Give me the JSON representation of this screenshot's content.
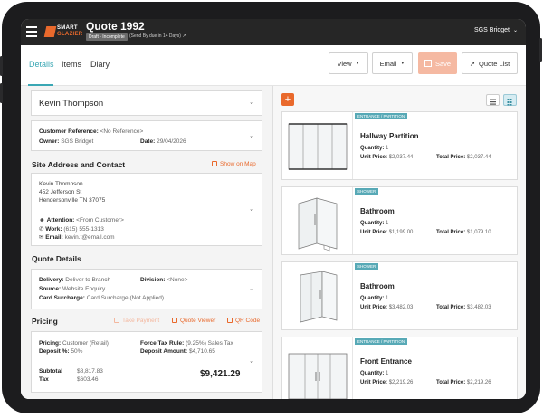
{
  "header": {
    "brand_line1": "SMART",
    "brand_line2": "GLAZIER",
    "title": "Quote 1992",
    "status_badge": "Draft - Incomplete",
    "send_by": "(Send By due in 14 Days)",
    "company": "SGS Bridget"
  },
  "tabs": [
    {
      "label": "Details",
      "active": true
    },
    {
      "label": "Items",
      "active": false
    },
    {
      "label": "Diary",
      "active": false
    }
  ],
  "toolbar": {
    "view_label": "View",
    "email_label": "Email",
    "save_label": "Save",
    "quote_list_label": "Quote List"
  },
  "customer": {
    "name": "Kevin Thompson",
    "reference_label": "Customer Reference:",
    "reference_value": "<No Reference>",
    "owner_label": "Owner:",
    "owner_value": "SGS Bridget",
    "date_label": "Date:",
    "date_value": "29/04/2026"
  },
  "site": {
    "section_title": "Site Address and Contact",
    "show_on_map": "Show on Map",
    "address_lines": [
      "Kevin Thompson",
      "452 Jefferson St",
      "Hendersonville TN 37075"
    ],
    "attention_label": "Attention:",
    "attention_value": "<From Customer>",
    "work_label": "Work:",
    "work_value": "(615) 555-1313",
    "email_label": "Email:",
    "email_value": "kevin.t@email.com"
  },
  "quote_details": {
    "section_title": "Quote Details",
    "delivery_label": "Delivery:",
    "delivery_value": "Deliver to Branch",
    "division_label": "Division:",
    "division_value": "<None>",
    "source_label": "Source:",
    "source_value": "Website Enquiry",
    "surcharge_label": "Card Surcharge:",
    "surcharge_value": "Card Surcharge (Not Applied)"
  },
  "pricing": {
    "section_title": "Pricing",
    "take_payment": "Take Payment",
    "quote_viewer": "Quote Viewer",
    "qr_code": "QR Code",
    "pricing_label": "Pricing:",
    "pricing_value": "Customer (Retail)",
    "deposit_pct_label": "Deposit %:",
    "deposit_pct_value": "50%",
    "tax_rule_label": "Force Tax Rule:",
    "tax_rule_value": "(9.25%) Sales Tax",
    "deposit_amount_label": "Deposit Amount:",
    "deposit_amount_value": "$4,710.65",
    "subtotal_label": "Subtotal",
    "subtotal_value": "$8,817.83",
    "tax_label": "Tax",
    "tax_value": "$603.46",
    "total": "$9,421.29"
  },
  "items": [
    {
      "badge": "ENTRANCE / PARTITION",
      "name": "Hallway Partition",
      "quantity_label": "Quantity:",
      "quantity": "1",
      "unit_price_label": "Unit Price:",
      "unit_price": "$2,037.44",
      "total_price_label": "Total Price:",
      "total_price": "$2,037.44"
    },
    {
      "badge": "SHOWER",
      "name": "Bathroom",
      "quantity_label": "Quantity:",
      "quantity": "1",
      "unit_price_label": "Unit Price:",
      "unit_price": "$1,199.00",
      "total_price_label": "Total Price:",
      "total_price": "$1,079.10"
    },
    {
      "badge": "SHOWER",
      "name": "Bathroom",
      "quantity_label": "Quantity:",
      "quantity": "1",
      "unit_price_label": "Unit Price:",
      "unit_price": "$3,482.03",
      "total_price_label": "Total Price:",
      "total_price": "$3,482.03"
    },
    {
      "badge": "ENTRANCE / PARTITION",
      "name": "Front Entrance",
      "quantity_label": "Quantity:",
      "quantity": "1",
      "unit_price_label": "Unit Price:",
      "unit_price": "$2,219.26",
      "total_price_label": "Total Price:",
      "total_price": "$2,219.26"
    }
  ],
  "colors": {
    "accent": "#3aa7b4",
    "orange": "#e9692c",
    "header_bg": "#262626",
    "badge_bg": "#57a9b6"
  }
}
